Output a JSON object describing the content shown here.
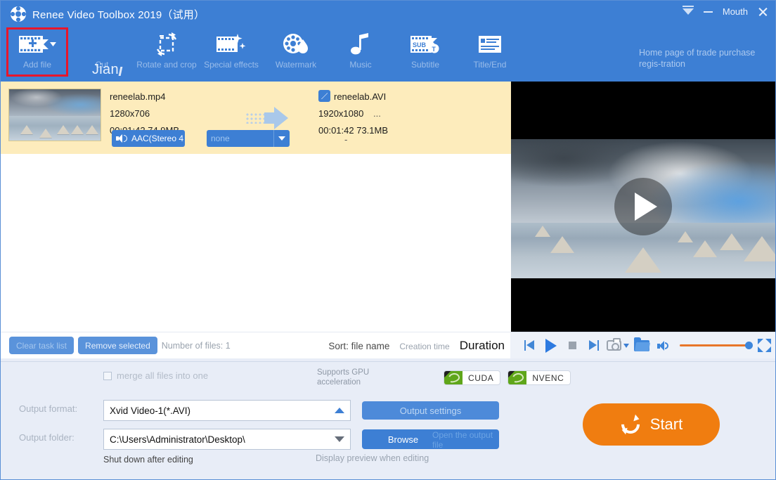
{
  "window": {
    "title": "Renee Video Toolbox 2019（试用）",
    "logo_icon": "film-reel-icon",
    "controls": {
      "dropdown_icon": "chevron-down-icon",
      "minimize_icon": "minimize-icon",
      "account_label": "Mouth",
      "close_icon": "close-icon"
    }
  },
  "toolbar": {
    "items": [
      {
        "label": "Add file",
        "icon": "film-add-icon",
        "active": true,
        "has_caret": true
      },
      {
        "label": "Cut",
        "icon": "scissors-crop-icon",
        "active": false,
        "has_caret": false
      },
      {
        "label": "Rotate and crop",
        "icon": "rotate-crop-icon",
        "active": false,
        "has_caret": false
      },
      {
        "label": "Special effects",
        "icon": "film-sparkle-icon",
        "active": false,
        "has_caret": false
      },
      {
        "label": "Watermark",
        "icon": "watermark-droplet-icon",
        "active": false,
        "has_caret": false
      },
      {
        "label": "Music",
        "icon": "music-note-icon",
        "active": false,
        "has_caret": false
      },
      {
        "label": "Subtitle",
        "icon": "subtitle-sub-icon",
        "active": false,
        "has_caret": false
      },
      {
        "label": "Title/End",
        "icon": "title-card-icon",
        "active": false,
        "has_caret": false
      }
    ],
    "overlay_text": "Jian",
    "home_link": "Home page of trade purchase regis-tration",
    "highlight_color": "#e8162b"
  },
  "file_list": {
    "rows": [
      {
        "thumbnail_icon": "video-thumbnail",
        "source": {
          "name": "reneelab.mp4",
          "resolution": "1280x706",
          "duration_size": "00:01:42  74.9MB"
        },
        "arrow_icon": "convert-arrow-icon",
        "output": {
          "edit_icon": "edit-pencil-icon",
          "name": "reneelab.AVI",
          "resolution": "1920x1080",
          "ellipsis": "...",
          "duration_size": "00:01:42  73.1MB"
        },
        "audio_track": {
          "icon": "speaker-icon",
          "value": "AAC(Stereo 4",
          "caret": "chevron-down-icon"
        },
        "subtitle_track": {
          "value": "none",
          "caret": "chevron-down-icon"
        },
        "separator": "-"
      }
    ]
  },
  "list_toolbar": {
    "clear_button": "Clear task list",
    "remove_button": "Remove selected",
    "count_text": "Number of files: 1",
    "sort_label": "Sort: file name",
    "creation_time": "Creation time",
    "duration": "Duration"
  },
  "player": {
    "play_overlay_icon": "play-overlay-icon",
    "controls": [
      {
        "icon": "previous-icon"
      },
      {
        "icon": "play-icon"
      },
      {
        "icon": "stop-icon"
      },
      {
        "icon": "next-icon"
      },
      {
        "icon": "snapshot-camera-icon"
      },
      {
        "icon": "open-folder-icon"
      },
      {
        "icon": "volume-icon"
      },
      {
        "icon": "fullscreen-icon"
      }
    ],
    "volume_percent": 100,
    "volume_track_color": "#e8762a"
  },
  "settings": {
    "merge_label": "merge all files into one",
    "merge_checked": false,
    "gpu_text": "Supports GPU acceleration",
    "badges": [
      {
        "label": "CUDA",
        "icon": "nvidia-icon"
      },
      {
        "label": "NVENC",
        "icon": "nvidia-icon"
      }
    ],
    "output_format_label": "Output format:",
    "output_format_value": "Xvid Video-1(*.AVI)",
    "output_format_caret": "chevron-up-icon",
    "output_settings_button": "Output settings",
    "output_folder_label": "Output folder:",
    "output_folder_value": "C:\\Users\\Administrator\\Desktop\\",
    "output_folder_caret": "chevron-down-icon",
    "browse_button": "Browse",
    "open_output_label": "Open the output file",
    "shutdown_label": "Shut down after editing",
    "preview_label": "Display preview when editing",
    "start_button": "Start",
    "start_icon": "refresh-icon",
    "start_color": "#f07d10"
  }
}
